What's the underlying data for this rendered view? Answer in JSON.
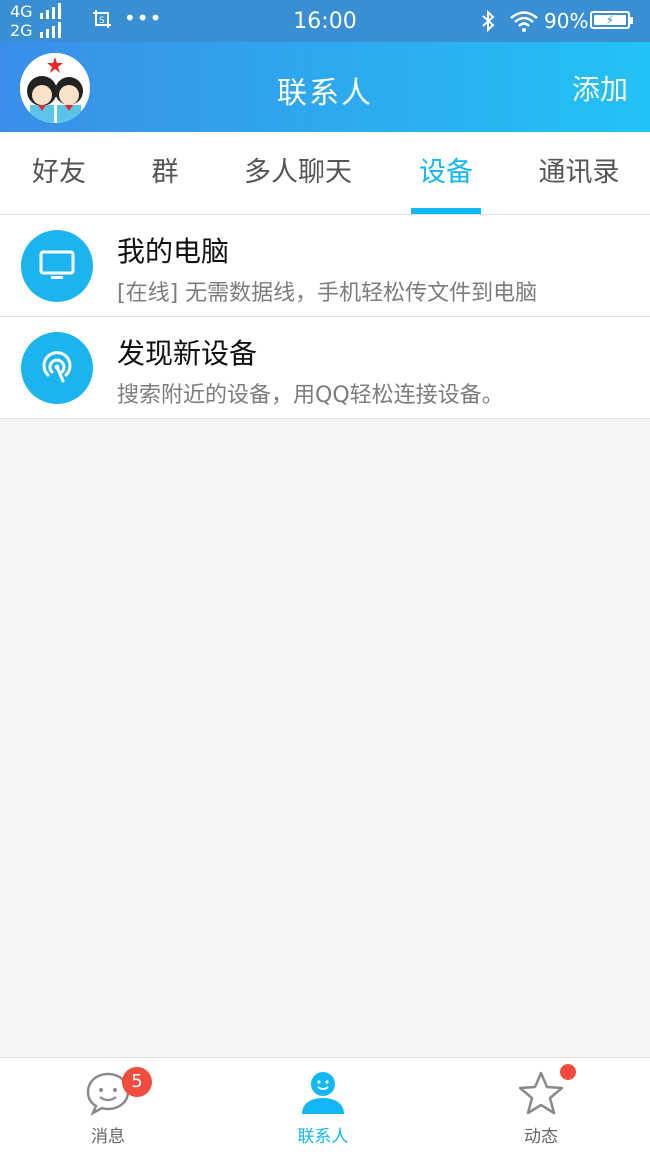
{
  "status_bar": {
    "net_top": "4G",
    "net_bottom": "2G",
    "screenshot_icon": "screenshot-icon",
    "more": "•••",
    "time": "16:00",
    "bluetooth_icon": "bluetooth-icon",
    "wifi_icon": "wifi-icon",
    "battery_percent": "90%",
    "battery_icon": "battery-charging-icon"
  },
  "header": {
    "title": "联系人",
    "add_label": "添加"
  },
  "tabs": [
    {
      "label": "好友",
      "active": false
    },
    {
      "label": "群",
      "active": false
    },
    {
      "label": "多人聊天",
      "active": false
    },
    {
      "label": "设备",
      "active": true
    },
    {
      "label": "通讯录",
      "active": false
    }
  ],
  "devices": [
    {
      "title": "我的电脑",
      "subtitle": "[在线] 无需数据线，手机轻松传文件到电脑",
      "icon": "monitor-icon"
    },
    {
      "title": "发现新设备",
      "subtitle": "搜索附近的设备，用QQ轻松连接设备。",
      "icon": "radar-icon"
    }
  ],
  "bottom_nav": [
    {
      "label": "消息",
      "icon": "chat-bubble-icon",
      "badge": "5",
      "active": false
    },
    {
      "label": "联系人",
      "icon": "contacts-person-icon",
      "active": true
    },
    {
      "label": "动态",
      "icon": "star-icon",
      "active": false,
      "has_dot": true
    }
  ],
  "colors": {
    "accent": "#12b7f5",
    "header_start": "#3a8ee8",
    "header_end": "#22c2f6",
    "badge": "#f24c3d"
  }
}
